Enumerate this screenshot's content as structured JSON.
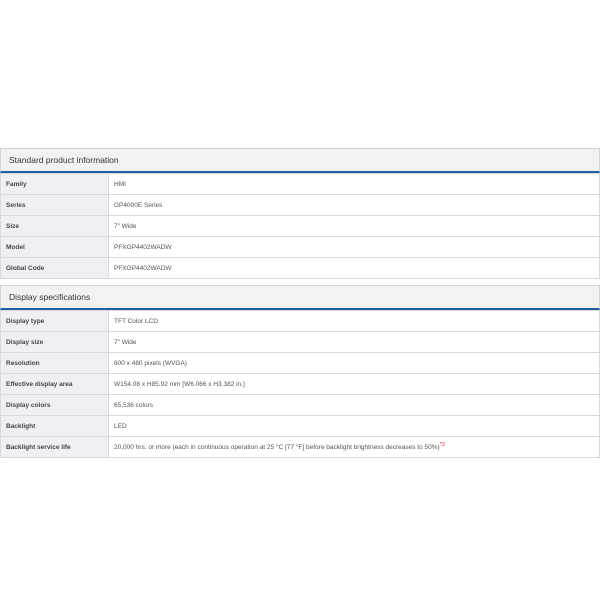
{
  "standard_product_information": {
    "title": "Standard product information",
    "rows": [
      {
        "label": "Family",
        "value": "HMI"
      },
      {
        "label": "Series",
        "value": "GP4000E Series"
      },
      {
        "label": "Size",
        "value": "7\" Wide"
      },
      {
        "label": "Model",
        "value": "PFXGP4402WADW"
      },
      {
        "label": "Global Code",
        "value": "PFXGP4402WADW"
      }
    ]
  },
  "display_specifications": {
    "title": "Display specifications",
    "rows": [
      {
        "label": "Display type",
        "value": "TFT Color LCD"
      },
      {
        "label": "Display size",
        "value": "7\" Wide"
      },
      {
        "label": "Resolution",
        "value": "800 x 480 pixels (WVGA)"
      },
      {
        "label": "Effective display area",
        "value": "W154.08 x H85.92 mm [W6.066 x H3.382 in.]"
      },
      {
        "label": "Display colors",
        "value": "65,536 colors"
      },
      {
        "label": "Backlight",
        "value": "LED"
      },
      {
        "label": "Backlight service life",
        "value": "20,000 hrs. or more (each in continuous operation at 25 °C [77 °F] before backlight brightness decreases to 50%)",
        "note": "*2"
      }
    ]
  },
  "colors": {
    "header_bar_accent": "#1f5fa8",
    "note_ref": "#d02020"
  }
}
